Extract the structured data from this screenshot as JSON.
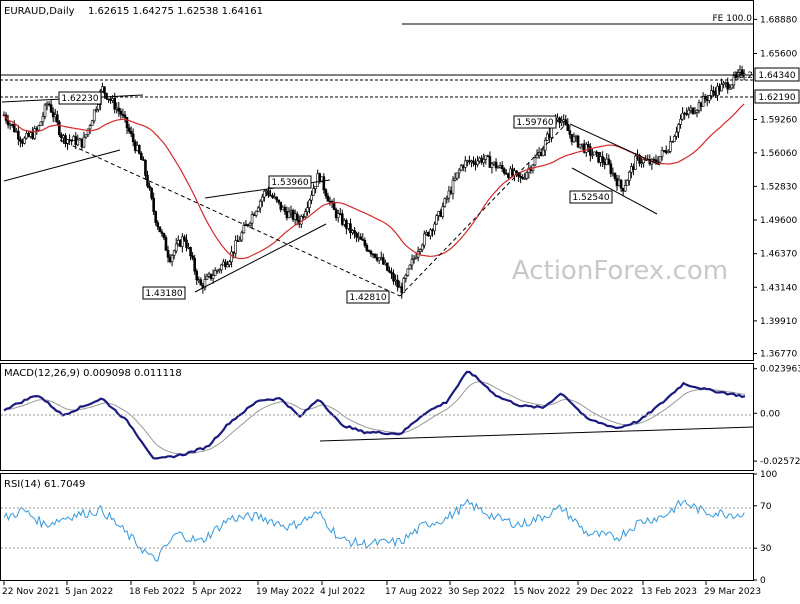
{
  "chart_data": [
    {
      "panel": "price",
      "type": "candlestick",
      "title": "EURAUD,Daily",
      "ohlc_readout": "1.62615 1.64275 1.62538 1.64161",
      "watermark": "ActionForex.com",
      "ylim": [
        1.3615,
        1.7055
      ],
      "y_ticks": [
        "1.68880",
        "1.65600",
        "1.62190",
        "1.59260",
        "1.56060",
        "1.52830",
        "1.49600",
        "1.46370",
        "1.43140",
        "1.39910",
        "1.36770"
      ],
      "x_ticks": [
        "22 Nov 2021",
        "5 Jan 2022",
        "18 Feb 2022",
        "5 Apr 2022",
        "19 May 2022",
        "4 Jul 2022",
        "17 Aug 2022",
        "30 Sep 2022",
        "15 Nov 2022",
        "29 Dec 2022",
        "13 Feb 2023",
        "29 Mar 2023"
      ],
      "last_price_label": "1.64340",
      "level_label": "1.62190",
      "fe_label": "FE 100.0",
      "fib_label": "38.2",
      "annotations": [
        "1.62230",
        "1.53960",
        "1.43180",
        "1.42810",
        "1.59760",
        "1.52540"
      ],
      "close_series": [
        {
          "date": "2021-11-22",
          "close": 1.597
        },
        {
          "date": "2021-12-05",
          "close": 1.572
        },
        {
          "date": "2021-12-15",
          "close": 1.582
        },
        {
          "date": "2021-12-22",
          "close": 1.61
        },
        {
          "date": "2022-01-01",
          "close": 1.575
        },
        {
          "date": "2022-01-15",
          "close": 1.57
        },
        {
          "date": "2022-01-28",
          "close": 1.6223
        },
        {
          "date": "2022-02-10",
          "close": 1.598
        },
        {
          "date": "2022-02-25",
          "close": 1.55
        },
        {
          "date": "2022-03-05",
          "close": 1.5
        },
        {
          "date": "2022-03-15",
          "close": 1.46
        },
        {
          "date": "2022-03-25",
          "close": 1.48
        },
        {
          "date": "2022-04-05",
          "close": 1.4318
        },
        {
          "date": "2022-04-25",
          "close": 1.46
        },
        {
          "date": "2022-05-10",
          "close": 1.5
        },
        {
          "date": "2022-05-20",
          "close": 1.525
        },
        {
          "date": "2022-06-01",
          "close": 1.505
        },
        {
          "date": "2022-06-12",
          "close": 1.495
        },
        {
          "date": "2022-06-25",
          "close": 1.5396
        },
        {
          "date": "2022-07-05",
          "close": 1.505
        },
        {
          "date": "2022-07-20",
          "close": 1.48
        },
        {
          "date": "2022-08-05",
          "close": 1.46
        },
        {
          "date": "2022-08-20",
          "close": 1.4281
        },
        {
          "date": "2022-09-01",
          "close": 1.47
        },
        {
          "date": "2022-09-15",
          "close": 1.5
        },
        {
          "date": "2022-10-01",
          "close": 1.55
        },
        {
          "date": "2022-10-15",
          "close": 1.555
        },
        {
          "date": "2022-10-28",
          "close": 1.545
        },
        {
          "date": "2022-11-10",
          "close": 1.535
        },
        {
          "date": "2022-11-25",
          "close": 1.565
        },
        {
          "date": "2022-12-05",
          "close": 1.5976
        },
        {
          "date": "2022-12-15",
          "close": 1.575
        },
        {
          "date": "2022-12-28",
          "close": 1.56
        },
        {
          "date": "2023-01-08",
          "close": 1.55
        },
        {
          "date": "2023-01-18",
          "close": 1.5254
        },
        {
          "date": "2023-01-28",
          "close": 1.555
        },
        {
          "date": "2023-02-08",
          "close": 1.55
        },
        {
          "date": "2023-02-18",
          "close": 1.565
        },
        {
          "date": "2023-02-28",
          "close": 1.595
        },
        {
          "date": "2023-03-10",
          "close": 1.605
        },
        {
          "date": "2023-03-22",
          "close": 1.62
        },
        {
          "date": "2023-04-05",
          "close": 1.63
        },
        {
          "date": "2023-04-12",
          "close": 1.6416
        }
      ]
    },
    {
      "panel": "macd",
      "type": "line",
      "title": "MACD(12,26,9) 0.009098 0.011118",
      "ylim": [
        -0.0305,
        0.0265
      ],
      "y_ticks": [
        "0.023963",
        "0.00",
        "-0.025726"
      ],
      "series_values": [
        {
          "date": "2021-11-22",
          "value": 0.002
        },
        {
          "date": "2021-12-15",
          "value": 0.01
        },
        {
          "date": "2022-01-01",
          "value": -0.001
        },
        {
          "date": "2022-01-28",
          "value": 0.008
        },
        {
          "date": "2022-02-15",
          "value": -0.005
        },
        {
          "date": "2022-03-05",
          "value": -0.025
        },
        {
          "date": "2022-03-25",
          "value": -0.022
        },
        {
          "date": "2022-04-10",
          "value": -0.018
        },
        {
          "date": "2022-04-25",
          "value": -0.005
        },
        {
          "date": "2022-05-15",
          "value": 0.007
        },
        {
          "date": "2022-05-30",
          "value": 0.008
        },
        {
          "date": "2022-06-12",
          "value": -0.002
        },
        {
          "date": "2022-06-25",
          "value": 0.008
        },
        {
          "date": "2022-07-10",
          "value": -0.006
        },
        {
          "date": "2022-07-25",
          "value": -0.01
        },
        {
          "date": "2022-08-20",
          "value": -0.011
        },
        {
          "date": "2022-09-05",
          "value": 0.0
        },
        {
          "date": "2022-09-20",
          "value": 0.006
        },
        {
          "date": "2022-10-05",
          "value": 0.023
        },
        {
          "date": "2022-10-25",
          "value": 0.009
        },
        {
          "date": "2022-11-10",
          "value": 0.004
        },
        {
          "date": "2022-11-25",
          "value": 0.003
        },
        {
          "date": "2022-12-08",
          "value": 0.011
        },
        {
          "date": "2022-12-25",
          "value": -0.003
        },
        {
          "date": "2023-01-15",
          "value": -0.008
        },
        {
          "date": "2023-01-30",
          "value": -0.004
        },
        {
          "date": "2023-02-15",
          "value": 0.006
        },
        {
          "date": "2023-03-01",
          "value": 0.016
        },
        {
          "date": "2023-03-15",
          "value": 0.013
        },
        {
          "date": "2023-04-12",
          "value": 0.009
        }
      ]
    },
    {
      "panel": "rsi",
      "type": "line",
      "title": "RSI(14) 61.7049",
      "ylim": [
        0,
        100
      ],
      "y_ticks": [
        "100",
        "70",
        "30",
        "0"
      ],
      "series_values": [
        {
          "date": "2021-11-22",
          "value": 58
        },
        {
          "date": "2021-12-05",
          "value": 66
        },
        {
          "date": "2021-12-20",
          "value": 52
        },
        {
          "date": "2022-01-05",
          "value": 60
        },
        {
          "date": "2022-01-28",
          "value": 66
        },
        {
          "date": "2022-02-15",
          "value": 42
        },
        {
          "date": "2022-03-05",
          "value": 18
        },
        {
          "date": "2022-03-20",
          "value": 44
        },
        {
          "date": "2022-04-05",
          "value": 36
        },
        {
          "date": "2022-04-25",
          "value": 58
        },
        {
          "date": "2022-05-15",
          "value": 60
        },
        {
          "date": "2022-06-05",
          "value": 50
        },
        {
          "date": "2022-06-25",
          "value": 63
        },
        {
          "date": "2022-07-10",
          "value": 38
        },
        {
          "date": "2022-07-25",
          "value": 34
        },
        {
          "date": "2022-08-20",
          "value": 36
        },
        {
          "date": "2022-09-05",
          "value": 52
        },
        {
          "date": "2022-09-20",
          "value": 58
        },
        {
          "date": "2022-10-05",
          "value": 72
        },
        {
          "date": "2022-10-25",
          "value": 58
        },
        {
          "date": "2022-11-10",
          "value": 52
        },
        {
          "date": "2022-11-25",
          "value": 60
        },
        {
          "date": "2022-12-08",
          "value": 68
        },
        {
          "date": "2022-12-25",
          "value": 44
        },
        {
          "date": "2023-01-15",
          "value": 40
        },
        {
          "date": "2023-01-30",
          "value": 55
        },
        {
          "date": "2023-02-15",
          "value": 60
        },
        {
          "date": "2023-03-01",
          "value": 74
        },
        {
          "date": "2023-03-15",
          "value": 64
        },
        {
          "date": "2023-04-12",
          "value": 61.7
        }
      ]
    }
  ],
  "colors": {
    "candle_up": "#ffffff",
    "candle_down": "#000000",
    "ma_line": "#d62728",
    "macd_line": "#1a1a80",
    "signal_line": "#999999",
    "rsi_line": "#3399dd",
    "trendline": "#000000",
    "watermark": "#c8c8c8"
  }
}
